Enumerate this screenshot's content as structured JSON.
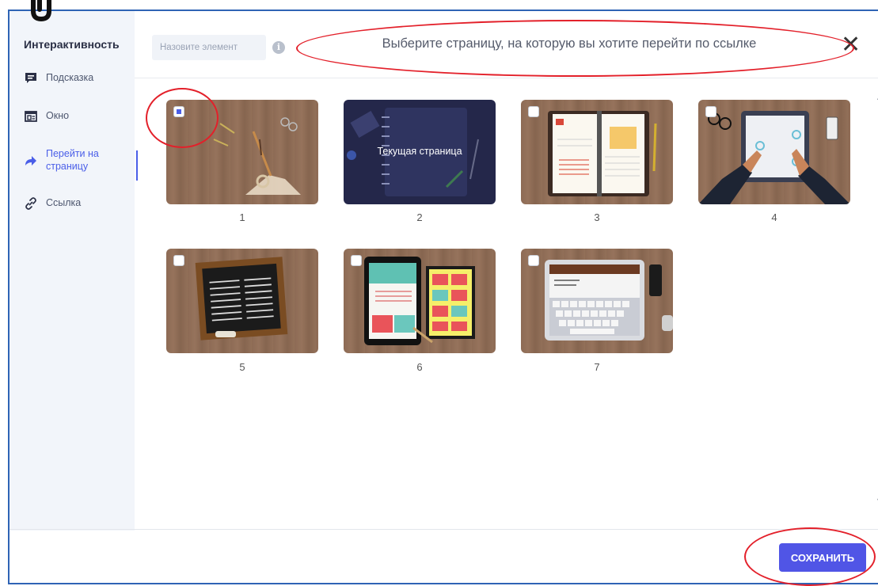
{
  "sidebar": {
    "title": "Интерактивность",
    "items": [
      {
        "label": "Подсказка",
        "icon": "tooltip-icon",
        "active": false
      },
      {
        "label": "Окно",
        "icon": "window-icon",
        "active": false
      },
      {
        "label": "Перейти на страницу",
        "icon": "arrow-right-icon",
        "active": true
      },
      {
        "label": "Ссылка",
        "icon": "link-icon",
        "active": false
      }
    ]
  },
  "header": {
    "name_placeholder": "Назовите элемент",
    "title": "Выберите страницу, на которую вы хотите перейти по ссылке",
    "close": "✕"
  },
  "pages": [
    {
      "number": "1",
      "checked": true,
      "current": false
    },
    {
      "number": "2",
      "checked": false,
      "current": true,
      "current_label": "Текущая страница"
    },
    {
      "number": "3",
      "checked": false,
      "current": false
    },
    {
      "number": "4",
      "checked": false,
      "current": false
    },
    {
      "number": "5",
      "checked": false,
      "current": false
    },
    {
      "number": "6",
      "checked": false,
      "current": false
    },
    {
      "number": "7",
      "checked": false,
      "current": false
    }
  ],
  "footer": {
    "save_label": "СОХРАНИТЬ"
  },
  "colors": {
    "accent": "#5055e6",
    "annotation": "#e3202a",
    "frame": "#2f64b5"
  }
}
